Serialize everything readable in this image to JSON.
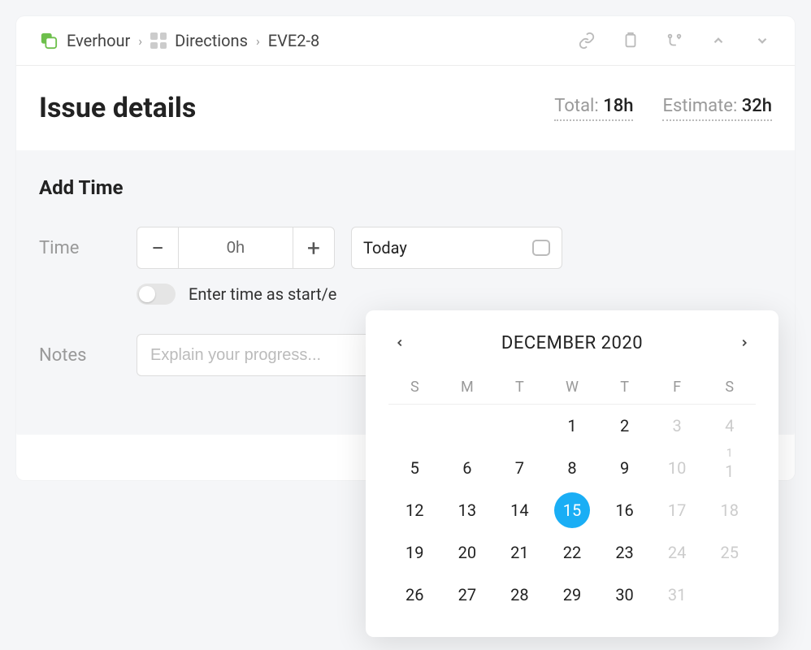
{
  "breadcrumbs": {
    "root": "Everhour",
    "project": "Directions",
    "issue": "EVE2-8"
  },
  "title": "Issue details",
  "stats": {
    "total_label": "Total:",
    "total_value": "18h",
    "estimate_label": "Estimate:",
    "estimate_value": "32h"
  },
  "add_time": {
    "heading": "Add Time",
    "time_label": "Time",
    "time_value": "0h",
    "date_text": "Today",
    "toggle_label": "Enter time as start/e",
    "notes_label": "Notes",
    "notes_placeholder": "Explain your progress..."
  },
  "calendar": {
    "title": "DECEMBER 2020",
    "dow": [
      "S",
      "M",
      "T",
      "W",
      "T",
      "F",
      "S"
    ],
    "weeks": [
      [
        {
          "d": "",
          "muted": true
        },
        {
          "d": "",
          "muted": true
        },
        {
          "d": "1"
        },
        {
          "d": "2"
        },
        {
          "d": "3",
          "muted": true
        },
        {
          "d": "4",
          "muted": true
        }
      ],
      [
        {
          "d": "5"
        },
        {
          "d": "6"
        },
        {
          "d": "7"
        },
        {
          "d": "8"
        },
        {
          "d": "9"
        },
        {
          "d": "10",
          "muted": true
        },
        {
          "d": "1",
          "muted": true,
          "overflow": "1"
        }
      ],
      [
        {
          "d": "12"
        },
        {
          "d": "13"
        },
        {
          "d": "14"
        },
        {
          "d": "15",
          "selected": true
        },
        {
          "d": "16"
        },
        {
          "d": "17",
          "muted": true
        },
        {
          "d": "18",
          "muted": true
        }
      ],
      [
        {
          "d": "19"
        },
        {
          "d": "20"
        },
        {
          "d": "21"
        },
        {
          "d": "22"
        },
        {
          "d": "23"
        },
        {
          "d": "24",
          "muted": true
        },
        {
          "d": "25",
          "muted": true
        }
      ],
      [
        {
          "d": "26"
        },
        {
          "d": "27"
        },
        {
          "d": "28"
        },
        {
          "d": "29"
        },
        {
          "d": "30"
        },
        {
          "d": "31",
          "muted": true
        },
        {
          "d": "",
          "muted": true
        }
      ]
    ],
    "first_row_leading_blanks": [
      "",
      ""
    ],
    "first_row_days": [
      {
        "d": "1"
      },
      {
        "d": "2"
      },
      {
        "d": "3",
        "muted": true
      },
      {
        "d": "4",
        "muted": true
      }
    ]
  }
}
